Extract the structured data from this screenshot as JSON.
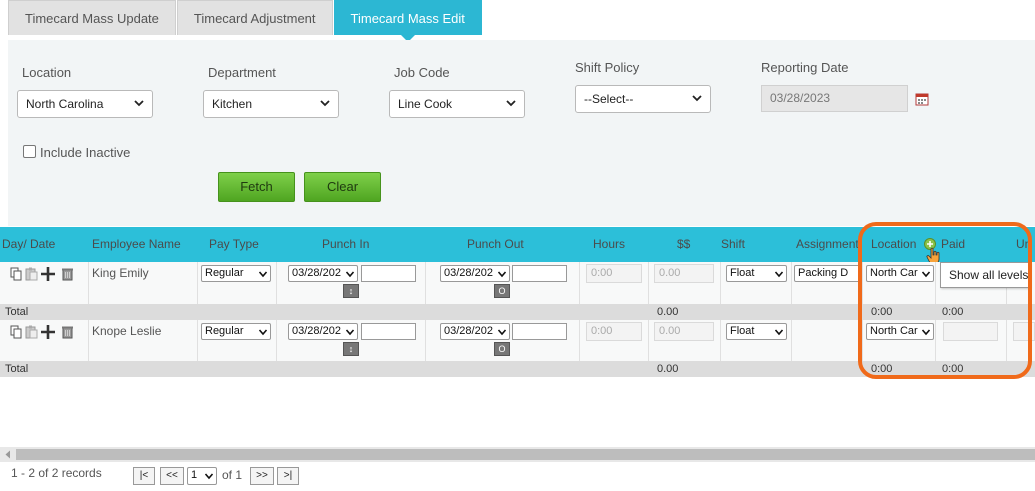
{
  "tabs": [
    "Timecard Mass Update",
    "Timecard Adjustment",
    "Timecard Mass Edit"
  ],
  "filters": {
    "location": {
      "label": "Location",
      "value": "North Carolina"
    },
    "department": {
      "label": "Department",
      "value": "Kitchen"
    },
    "job_code": {
      "label": "Job Code",
      "value": "Line Cook"
    },
    "shift_policy": {
      "label": "Shift Policy",
      "value": "--Select--"
    },
    "reporting_date": {
      "label": "Reporting Date",
      "value": "03/28/2023"
    },
    "include_inactive": {
      "label": "Include Inactive",
      "checked": false
    },
    "fetch_label": "Fetch",
    "clear_label": "Clear"
  },
  "grid": {
    "columns": [
      "Day/ Date",
      "Employee Name",
      "Pay Type",
      "Punch In",
      "Punch Out",
      "Hours",
      "$$",
      "Shift",
      "Assignment",
      "Location",
      "Paid",
      "Un"
    ],
    "rows": [
      {
        "employee": "King Emily",
        "pay_type": "Regular",
        "punch_in": "03/28/202",
        "punch_out": "03/28/202",
        "hours": "0:00",
        "dollars": "0.00",
        "shift": "Float",
        "assignment": "Packing D",
        "location": "North Car"
      },
      {
        "employee": "Knope Leslie",
        "pay_type": "Regular",
        "punch_in": "03/28/202",
        "punch_out": "03/28/202",
        "hours": "0:00",
        "dollars": "0.00",
        "shift": "Float",
        "assignment": "",
        "location": "North Car"
      }
    ],
    "totals": [
      {
        "label": "Total",
        "dollars": "0.00",
        "location": "0:00",
        "paid": "0:00"
      },
      {
        "label": "Total",
        "dollars": "0.00",
        "location": "0:00",
        "paid": "0:00"
      }
    ],
    "punch_in_button": "↕",
    "punch_out_button": "O"
  },
  "tooltip": "Show all levels",
  "pager": {
    "records": "1 - 2 of 2 records",
    "first": "|<",
    "prev": "<<",
    "page": "1",
    "of_label": "of 1",
    "next": ">>",
    "last": ">|"
  },
  "colors": {
    "header_bg": "#2cbfd9",
    "active_tab": "#2cb7d3",
    "button_green": "#5cb82e",
    "highlight": "#f06a1a"
  }
}
